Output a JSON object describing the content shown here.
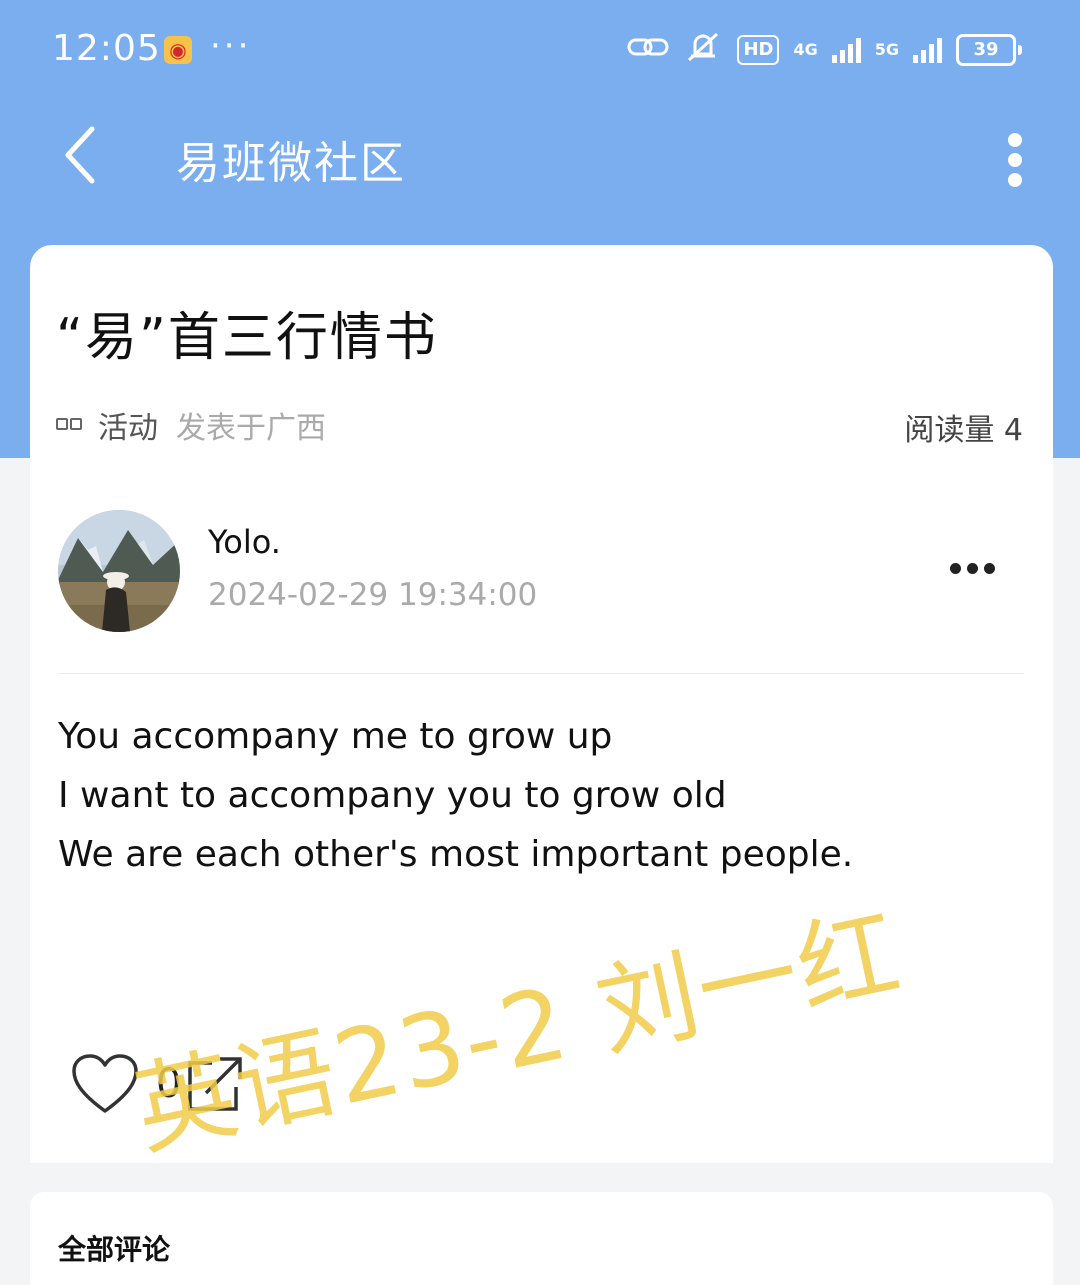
{
  "status_bar": {
    "time": "12:05",
    "weibo_icon": "weibo-icon",
    "more": "···",
    "hd_label": "HD",
    "net1": "4G",
    "net2": "5G",
    "battery": "39"
  },
  "nav": {
    "title": "易班微社区",
    "back_icon": "back-chevron-icon",
    "menu_icon": "vertical-more-icon"
  },
  "post": {
    "title": "“易”首三行情书",
    "category": "活动",
    "location": "发表于广西",
    "views": "阅读量 4",
    "author": "Yolo.",
    "time": "2024-02-29 19:34:00",
    "lines": [
      "You accompany me to grow up",
      "I want to accompany you to grow old",
      "We are each other's most important people."
    ],
    "like_count": "0"
  },
  "comments": {
    "title": "全部评论"
  },
  "watermark": "英语23-2 刘一红",
  "colors": {
    "header_bg": "#7aaeef",
    "page_bg": "#f3f4f6",
    "watermark": "#f0cc4a"
  }
}
